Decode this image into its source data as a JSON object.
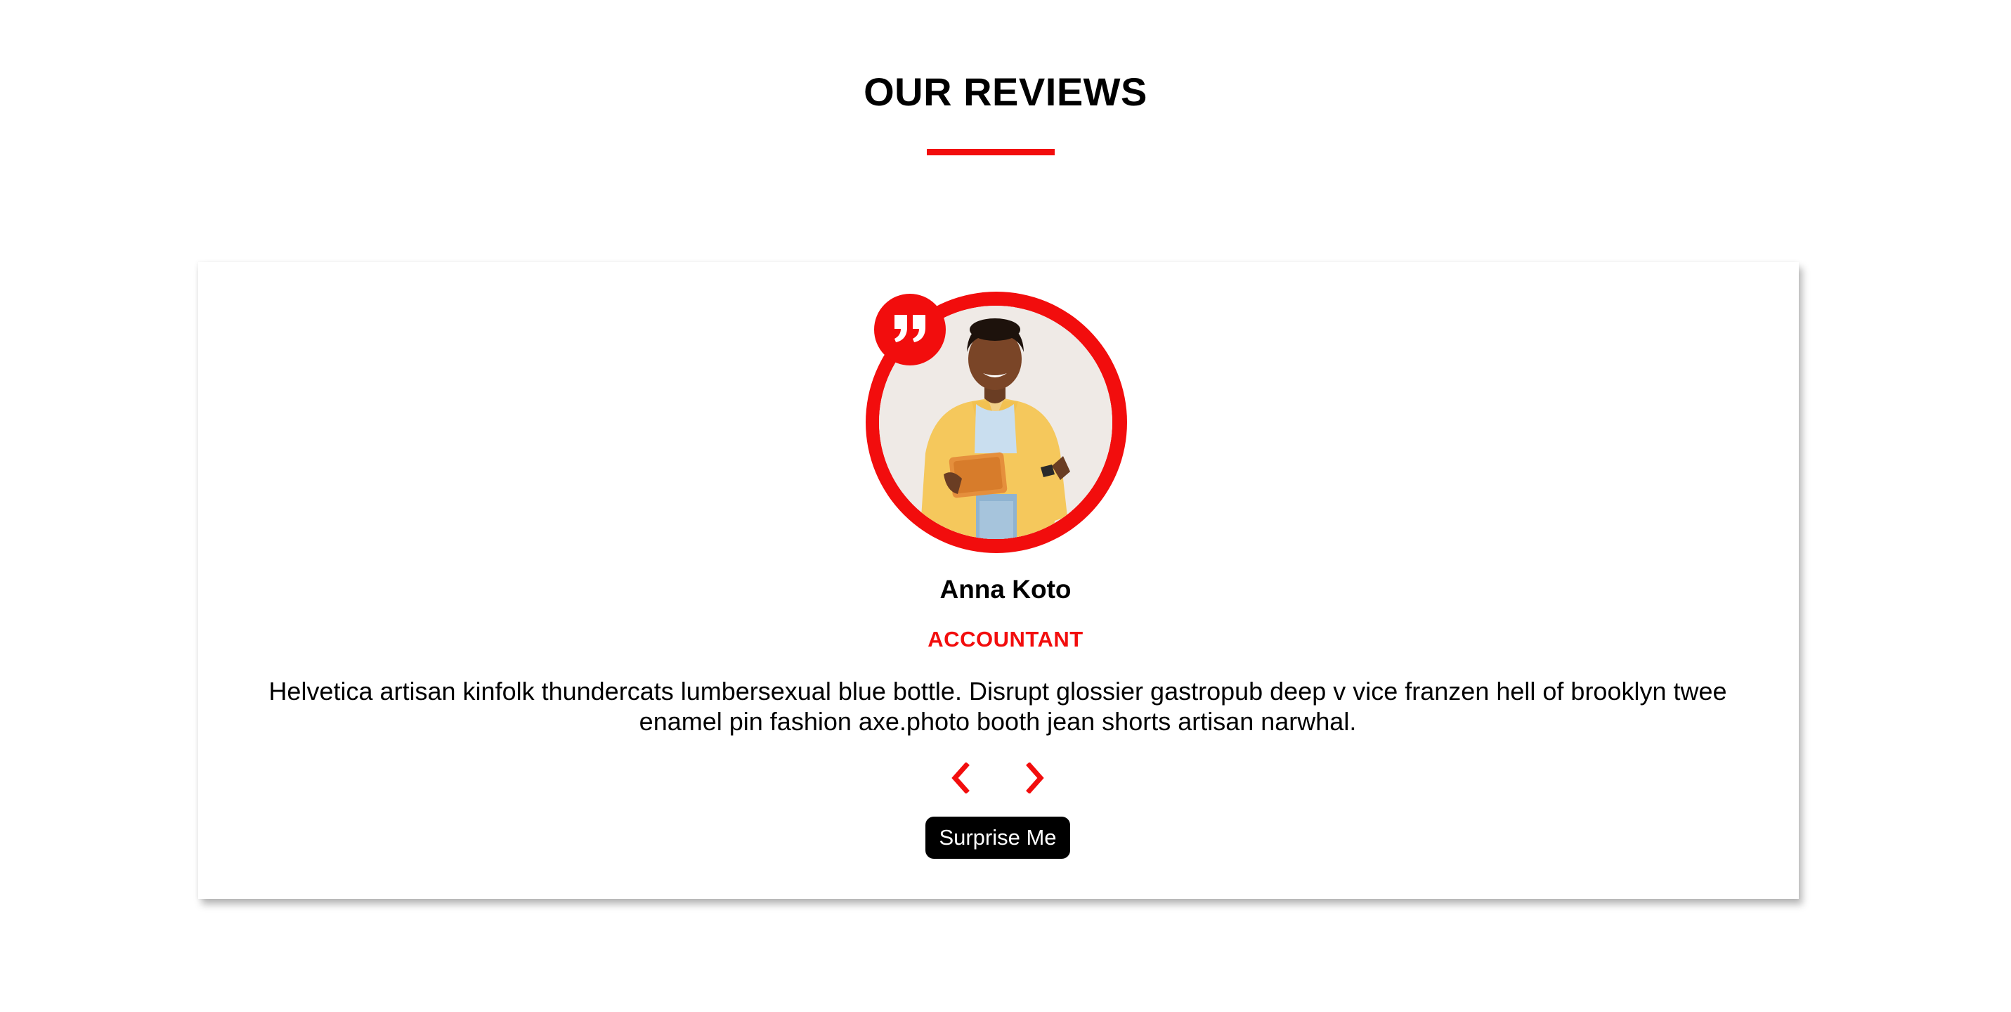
{
  "section": {
    "title": "OUR REVIEWS",
    "accent_color": "#f20d0d"
  },
  "review": {
    "name": "Anna Koto",
    "job": "ACCOUNTANT",
    "text": "Helvetica artisan kinfolk thundercats lumbersexual blue bottle. Disrupt glossier gastropub deep v vice franzen hell of brooklyn twee enamel pin fashion axe.photo booth jean shorts artisan narwhal.",
    "avatar_description": "woman-holding-tablet-photo",
    "quote_icon": "quote-right-icon"
  },
  "controls": {
    "prev_icon": "chevron-left-icon",
    "next_icon": "chevron-right-icon",
    "surprise_label": "Surprise Me"
  }
}
